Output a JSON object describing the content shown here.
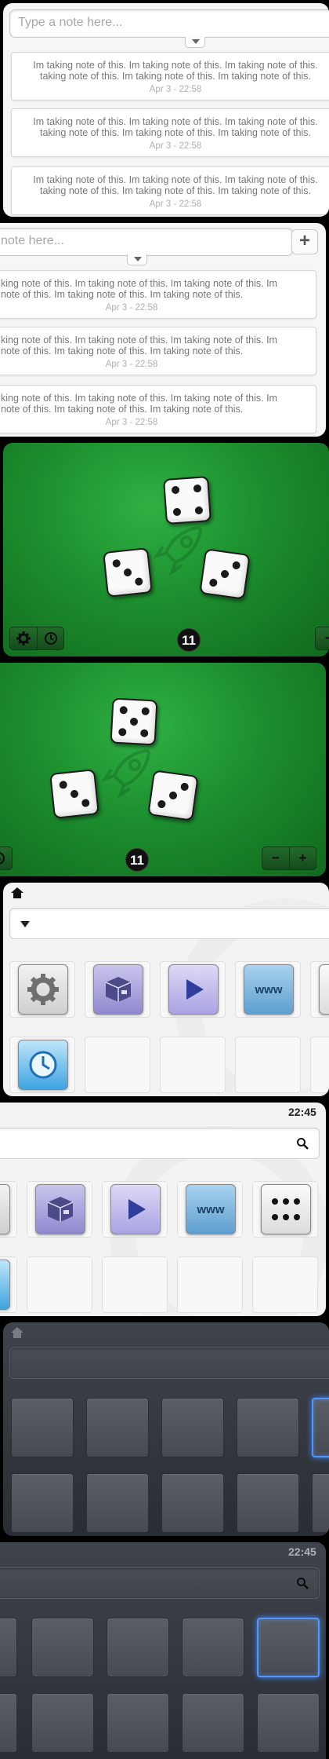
{
  "notes": {
    "input_placeholder": "Type a note here...",
    "input_placeholder_cropped": "note here...",
    "add_label": "+",
    "items": [
      {
        "line1": "Im taking note of this. Im taking note of this. Im taking note of this.",
        "line2": "taking note of this. Im taking note of this. Im taking note of this.",
        "line1_cropped": "king note of this. Im taking note of this. Im taking note of this. Im",
        "line2_cropped": "note of this. Im taking note of this. Im taking note of this.",
        "time": "Apr 3 - 22:58"
      },
      {
        "line1": "Im taking note of this. Im taking note of this. Im taking note of this.",
        "line2": "taking note of this. Im taking note of this. Im taking note of this.",
        "line1_cropped": "king note of this. Im taking note of this. Im taking note of this. Im",
        "line2_cropped": "note of this. Im taking note of this. Im taking note of this.",
        "time": "Apr 3 - 22:58"
      },
      {
        "line1": "Im taking note of this. Im taking note of this. Im taking note of this.",
        "line2": "taking note of this. Im taking note of this. Im taking note of this.",
        "line1_cropped": "king note of this. Im taking note of this. Im taking note of this. Im",
        "line2_cropped": "note of this. Im taking note of this. Im taking note of this.",
        "time": "Apr 3 - 22:58"
      }
    ]
  },
  "dice": {
    "total": "11",
    "values": [
      4,
      3,
      3
    ],
    "settings_icon": "gear-icon",
    "history_icon": "clock-icon",
    "minus_label": "−",
    "plus_label": "+",
    "colors": {
      "felt": "#1c8e2e",
      "die": "#fafafa"
    }
  },
  "launcher": {
    "clock": "22:45",
    "apps": [
      {
        "name": "settings",
        "icon": "gear-icon"
      },
      {
        "name": "packages",
        "icon": "package-icon"
      },
      {
        "name": "media-player",
        "icon": "play-icon"
      },
      {
        "name": "browser",
        "icon": "www-icon",
        "label": "www"
      },
      {
        "name": "dice",
        "icon": "dice-icon"
      },
      {
        "name": "clock",
        "icon": "clock-icon"
      }
    ],
    "dark_theme": {
      "background": "#2e3137",
      "selected_border": "#4f97ff"
    }
  }
}
